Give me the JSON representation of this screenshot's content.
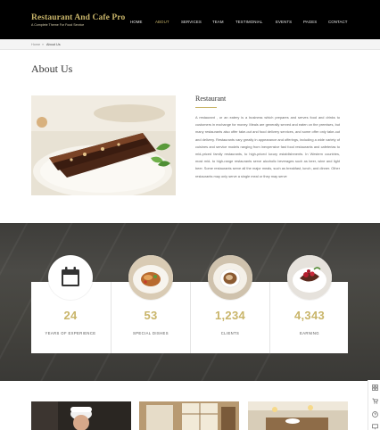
{
  "header": {
    "logo_title": "Restaurant And Cafe Pro",
    "logo_subtitle": "A Complete Theme For Food Service",
    "nav": [
      {
        "label": "HOME"
      },
      {
        "label": "ABOUT"
      },
      {
        "label": "SERVICES"
      },
      {
        "label": "TEAM"
      },
      {
        "label": "TESTIMONIAL"
      },
      {
        "label": "EVENTS"
      },
      {
        "label": "PAGES"
      },
      {
        "label": "CONTACT"
      }
    ],
    "active_nav": "ABOUT"
  },
  "breadcrumb": {
    "home": "Home",
    "separator": "»",
    "current": "About Us"
  },
  "about": {
    "title": "About Us",
    "heading": "Restaurant",
    "body": "A restaurant , or an eatery is a business which prepares and serves food and drinks to customers in exchange for money. Meals are generally served and eaten on the premises, but many restaurants also offer take-out and food delivery services, and some offer only take-out and delivery. Restaurants vary greatly in appearance and offerings, including a wide variety of cuisines and service models ranging from inexpensive fast food restaurants and cafeterias to mid-priced family restaurants, to high-priced luxury establishments. In Western countries, most mid- to high-range restaurants serve alcoholic beverages such as beer, wine and light beer. Some restaurants serve all the major meals, such as breakfast, lunch, and dinner. Other restaurants may only serve a single meal or they may serve"
  },
  "stats": [
    {
      "value": "24",
      "label": "YEARS OF EXPERIENCE",
      "icon": "calendar-icon"
    },
    {
      "value": "53",
      "label": "SPECIAL DISHES",
      "icon": "dish-photo"
    },
    {
      "value": "1,234",
      "label": "CLIENTS",
      "icon": "coffee-photo"
    },
    {
      "value": "4,343",
      "label": "EARNING",
      "icon": "dessert-photo"
    }
  ],
  "colors": {
    "accent": "#c9b56a",
    "header_bg": "#000000",
    "band_bg": "#44433f"
  },
  "sidebar_icons": [
    "grid-icon",
    "cart-icon",
    "help-icon",
    "monitor-icon"
  ]
}
